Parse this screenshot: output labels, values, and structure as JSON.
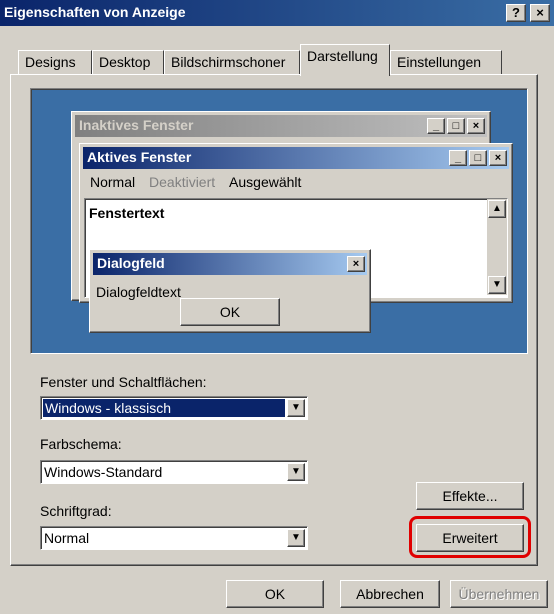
{
  "window": {
    "title": "Eigenschaften von Anzeige",
    "help_label": "?",
    "close_label": "×"
  },
  "tabs": [
    {
      "label": "Designs"
    },
    {
      "label": "Desktop"
    },
    {
      "label": "Bildschirmschoner"
    },
    {
      "label": "Darstellung",
      "active": true
    },
    {
      "label": "Einstellungen"
    }
  ],
  "preview": {
    "inactive_title": "Inaktives Fenster",
    "active_title": "Aktives Fenster",
    "menu": {
      "normal": "Normal",
      "disabled": "Deaktiviert",
      "selected": "Ausgewählt"
    },
    "window_text": "Fenstertext",
    "dialog_title": "Dialogfeld",
    "dialog_text": "Dialogfeldtext",
    "dialog_ok": "OK",
    "btn_min": "_",
    "btn_max": "□",
    "btn_close": "×"
  },
  "form": {
    "windows_buttons_label": "Fenster und Schaltflächen:",
    "windows_buttons_value": "Windows - klassisch",
    "color_scheme_label": "Farbschema:",
    "color_scheme_value": "Windows-Standard",
    "font_size_label": "Schriftgrad:",
    "font_size_value": "Normal",
    "effects_button": "Effekte...",
    "advanced_button": "Erweitert"
  },
  "footer": {
    "ok": "OK",
    "cancel": "Abbrechen",
    "apply": "Übernehmen"
  },
  "colors": {
    "titlebar_start": "#0a246a",
    "titlebar_end": "#3a6ea5",
    "desktop_preview": "#3a6ea5",
    "highlight": "#0a246a",
    "annotation_outline": "#e00000"
  }
}
